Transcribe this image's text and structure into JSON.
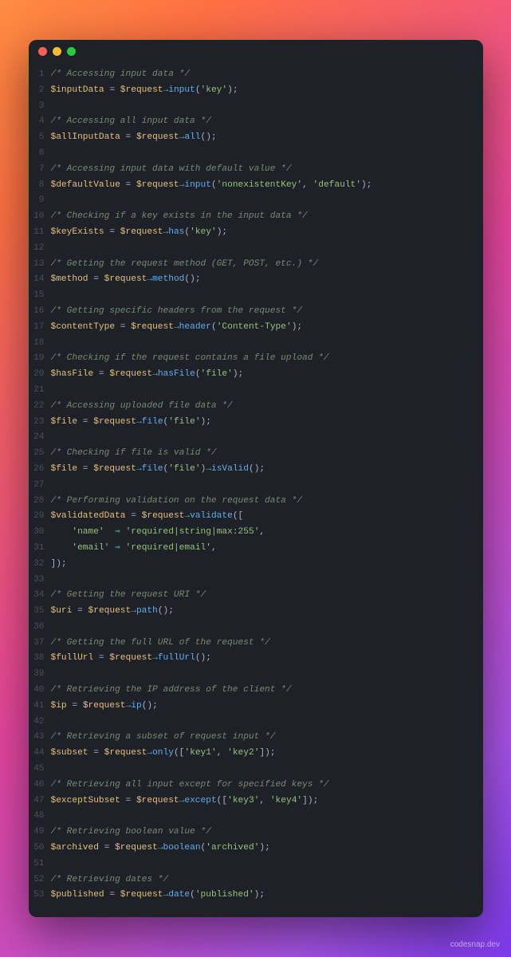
{
  "watermark": "codesnap.dev",
  "lines": [
    {
      "n": 1,
      "tokens": [
        {
          "t": "/* Accessing input data */",
          "c": "c"
        }
      ]
    },
    {
      "n": 2,
      "tokens": [
        {
          "t": "$inputData",
          "c": "v"
        },
        {
          "t": " = ",
          "c": "eq"
        },
        {
          "t": "$request",
          "c": "v"
        },
        {
          "t": "→",
          "c": "arr"
        },
        {
          "t": "input",
          "c": "fn"
        },
        {
          "t": "(",
          "c": "p"
        },
        {
          "t": "'key'",
          "c": "s"
        },
        {
          "t": ");",
          "c": "p"
        }
      ]
    },
    {
      "n": 3,
      "tokens": []
    },
    {
      "n": 4,
      "tokens": [
        {
          "t": "/* Accessing all input data */",
          "c": "c"
        }
      ]
    },
    {
      "n": 5,
      "tokens": [
        {
          "t": "$allInputData",
          "c": "v"
        },
        {
          "t": " = ",
          "c": "eq"
        },
        {
          "t": "$request",
          "c": "v"
        },
        {
          "t": "→",
          "c": "arr"
        },
        {
          "t": "all",
          "c": "fn"
        },
        {
          "t": "();",
          "c": "p"
        }
      ]
    },
    {
      "n": 6,
      "tokens": []
    },
    {
      "n": 7,
      "tokens": [
        {
          "t": "/* Accessing input data with default value */",
          "c": "c"
        }
      ]
    },
    {
      "n": 8,
      "tokens": [
        {
          "t": "$defaultValue",
          "c": "v"
        },
        {
          "t": " = ",
          "c": "eq"
        },
        {
          "t": "$request",
          "c": "v"
        },
        {
          "t": "→",
          "c": "arr"
        },
        {
          "t": "input",
          "c": "fn"
        },
        {
          "t": "(",
          "c": "p"
        },
        {
          "t": "'nonexistentKey'",
          "c": "s"
        },
        {
          "t": ", ",
          "c": "p"
        },
        {
          "t": "'default'",
          "c": "s"
        },
        {
          "t": ");",
          "c": "p"
        }
      ]
    },
    {
      "n": 9,
      "tokens": []
    },
    {
      "n": 10,
      "tokens": [
        {
          "t": "/* Checking if a key exists in the input data */",
          "c": "c"
        }
      ]
    },
    {
      "n": 11,
      "tokens": [
        {
          "t": "$keyExists",
          "c": "v"
        },
        {
          "t": " = ",
          "c": "eq"
        },
        {
          "t": "$request",
          "c": "v"
        },
        {
          "t": "→",
          "c": "arr"
        },
        {
          "t": "has",
          "c": "fn"
        },
        {
          "t": "(",
          "c": "p"
        },
        {
          "t": "'key'",
          "c": "s"
        },
        {
          "t": ");",
          "c": "p"
        }
      ]
    },
    {
      "n": 12,
      "tokens": []
    },
    {
      "n": 13,
      "tokens": [
        {
          "t": "/* Getting the request method (GET, POST, etc.) */",
          "c": "c"
        }
      ]
    },
    {
      "n": 14,
      "tokens": [
        {
          "t": "$method",
          "c": "v"
        },
        {
          "t": " = ",
          "c": "eq"
        },
        {
          "t": "$request",
          "c": "v"
        },
        {
          "t": "→",
          "c": "arr"
        },
        {
          "t": "method",
          "c": "fn"
        },
        {
          "t": "();",
          "c": "p"
        }
      ]
    },
    {
      "n": 15,
      "tokens": []
    },
    {
      "n": 16,
      "tokens": [
        {
          "t": "/* Getting specific headers from the request */",
          "c": "c"
        }
      ]
    },
    {
      "n": 17,
      "tokens": [
        {
          "t": "$contentType",
          "c": "v"
        },
        {
          "t": " = ",
          "c": "eq"
        },
        {
          "t": "$request",
          "c": "v"
        },
        {
          "t": "→",
          "c": "arr"
        },
        {
          "t": "header",
          "c": "fn"
        },
        {
          "t": "(",
          "c": "p"
        },
        {
          "t": "'Content-Type'",
          "c": "s"
        },
        {
          "t": ");",
          "c": "p"
        }
      ]
    },
    {
      "n": 18,
      "tokens": []
    },
    {
      "n": 19,
      "tokens": [
        {
          "t": "/* Checking if the request contains a file upload */",
          "c": "c"
        }
      ]
    },
    {
      "n": 20,
      "tokens": [
        {
          "t": "$hasFile",
          "c": "v"
        },
        {
          "t": " = ",
          "c": "eq"
        },
        {
          "t": "$request",
          "c": "v"
        },
        {
          "t": "→",
          "c": "arr"
        },
        {
          "t": "hasFile",
          "c": "fn"
        },
        {
          "t": "(",
          "c": "p"
        },
        {
          "t": "'file'",
          "c": "s"
        },
        {
          "t": ");",
          "c": "p"
        }
      ]
    },
    {
      "n": 21,
      "tokens": []
    },
    {
      "n": 22,
      "tokens": [
        {
          "t": "/* Accessing uploaded file data */",
          "c": "c"
        }
      ]
    },
    {
      "n": 23,
      "tokens": [
        {
          "t": "$file",
          "c": "v"
        },
        {
          "t": " = ",
          "c": "eq"
        },
        {
          "t": "$request",
          "c": "v"
        },
        {
          "t": "→",
          "c": "arr"
        },
        {
          "t": "file",
          "c": "fn"
        },
        {
          "t": "(",
          "c": "p"
        },
        {
          "t": "'file'",
          "c": "s"
        },
        {
          "t": ");",
          "c": "p"
        }
      ]
    },
    {
      "n": 24,
      "tokens": []
    },
    {
      "n": 25,
      "tokens": [
        {
          "t": "/* Checking if file is valid */",
          "c": "c"
        }
      ]
    },
    {
      "n": 26,
      "tokens": [
        {
          "t": "$file",
          "c": "v"
        },
        {
          "t": " = ",
          "c": "eq"
        },
        {
          "t": "$request",
          "c": "v"
        },
        {
          "t": "→",
          "c": "arr"
        },
        {
          "t": "file",
          "c": "fn"
        },
        {
          "t": "(",
          "c": "p"
        },
        {
          "t": "'file'",
          "c": "s"
        },
        {
          "t": ")",
          "c": "p"
        },
        {
          "t": "→",
          "c": "arr"
        },
        {
          "t": "isValid",
          "c": "fn"
        },
        {
          "t": "();",
          "c": "p"
        }
      ]
    },
    {
      "n": 27,
      "tokens": []
    },
    {
      "n": 28,
      "tokens": [
        {
          "t": "/* Performing validation on the request data */",
          "c": "c"
        }
      ]
    },
    {
      "n": 29,
      "tokens": [
        {
          "t": "$validatedData",
          "c": "v"
        },
        {
          "t": " = ",
          "c": "eq"
        },
        {
          "t": "$request",
          "c": "v"
        },
        {
          "t": "→",
          "c": "arr"
        },
        {
          "t": "validate",
          "c": "fn"
        },
        {
          "t": "([",
          "c": "p"
        }
      ]
    },
    {
      "n": 30,
      "tokens": [
        {
          "t": "    ",
          "c": "p"
        },
        {
          "t": "'name'",
          "c": "s"
        },
        {
          "t": "  ",
          "c": "p"
        },
        {
          "t": "⇒",
          "c": "arr"
        },
        {
          "t": " ",
          "c": "p"
        },
        {
          "t": "'required|string|max:255'",
          "c": "s"
        },
        {
          "t": ",",
          "c": "p"
        }
      ]
    },
    {
      "n": 31,
      "tokens": [
        {
          "t": "    ",
          "c": "p"
        },
        {
          "t": "'email'",
          "c": "s"
        },
        {
          "t": " ",
          "c": "p"
        },
        {
          "t": "⇒",
          "c": "arr"
        },
        {
          "t": " ",
          "c": "p"
        },
        {
          "t": "'required|email'",
          "c": "s"
        },
        {
          "t": ",",
          "c": "p"
        }
      ]
    },
    {
      "n": 32,
      "tokens": [
        {
          "t": "]);",
          "c": "p"
        }
      ]
    },
    {
      "n": 33,
      "tokens": []
    },
    {
      "n": 34,
      "tokens": [
        {
          "t": "/* Getting the request URI */",
          "c": "c"
        }
      ]
    },
    {
      "n": 35,
      "tokens": [
        {
          "t": "$uri",
          "c": "v"
        },
        {
          "t": " = ",
          "c": "eq"
        },
        {
          "t": "$request",
          "c": "v"
        },
        {
          "t": "→",
          "c": "arr"
        },
        {
          "t": "path",
          "c": "fn"
        },
        {
          "t": "();",
          "c": "p"
        }
      ]
    },
    {
      "n": 36,
      "tokens": []
    },
    {
      "n": 37,
      "tokens": [
        {
          "t": "/* Getting the full URL of the request */",
          "c": "c"
        }
      ]
    },
    {
      "n": 38,
      "tokens": [
        {
          "t": "$fullUrl",
          "c": "v"
        },
        {
          "t": " = ",
          "c": "eq"
        },
        {
          "t": "$request",
          "c": "v"
        },
        {
          "t": "→",
          "c": "arr"
        },
        {
          "t": "fullUrl",
          "c": "fn"
        },
        {
          "t": "();",
          "c": "p"
        }
      ]
    },
    {
      "n": 39,
      "tokens": []
    },
    {
      "n": 40,
      "tokens": [
        {
          "t": "/* Retrieving the IP address of the client */",
          "c": "c"
        }
      ]
    },
    {
      "n": 41,
      "tokens": [
        {
          "t": "$ip",
          "c": "v"
        },
        {
          "t": " = ",
          "c": "eq"
        },
        {
          "t": "$request",
          "c": "v"
        },
        {
          "t": "→",
          "c": "arr"
        },
        {
          "t": "ip",
          "c": "fn"
        },
        {
          "t": "();",
          "c": "p"
        }
      ]
    },
    {
      "n": 42,
      "tokens": []
    },
    {
      "n": 43,
      "tokens": [
        {
          "t": "/* Retrieving a subset of request input */",
          "c": "c"
        }
      ]
    },
    {
      "n": 44,
      "tokens": [
        {
          "t": "$subset",
          "c": "v"
        },
        {
          "t": " = ",
          "c": "eq"
        },
        {
          "t": "$request",
          "c": "v"
        },
        {
          "t": "→",
          "c": "arr"
        },
        {
          "t": "only",
          "c": "fn"
        },
        {
          "t": "([",
          "c": "p"
        },
        {
          "t": "'key1'",
          "c": "s"
        },
        {
          "t": ", ",
          "c": "p"
        },
        {
          "t": "'key2'",
          "c": "s"
        },
        {
          "t": "]);",
          "c": "p"
        }
      ]
    },
    {
      "n": 45,
      "tokens": []
    },
    {
      "n": 46,
      "tokens": [
        {
          "t": "/* Retrieving all input except for specified keys */",
          "c": "c"
        }
      ]
    },
    {
      "n": 47,
      "tokens": [
        {
          "t": "$exceptSubset",
          "c": "v"
        },
        {
          "t": " = ",
          "c": "eq"
        },
        {
          "t": "$request",
          "c": "v"
        },
        {
          "t": "→",
          "c": "arr"
        },
        {
          "t": "except",
          "c": "fn"
        },
        {
          "t": "([",
          "c": "p"
        },
        {
          "t": "'key3'",
          "c": "s"
        },
        {
          "t": ", ",
          "c": "p"
        },
        {
          "t": "'key4'",
          "c": "s"
        },
        {
          "t": "]);",
          "c": "p"
        }
      ]
    },
    {
      "n": 48,
      "tokens": []
    },
    {
      "n": 49,
      "tokens": [
        {
          "t": "/* Retrieving boolean value */",
          "c": "c"
        }
      ]
    },
    {
      "n": 50,
      "tokens": [
        {
          "t": "$archived",
          "c": "v"
        },
        {
          "t": " = ",
          "c": "eq"
        },
        {
          "t": "$request",
          "c": "v"
        },
        {
          "t": "→",
          "c": "arr"
        },
        {
          "t": "boolean",
          "c": "fn"
        },
        {
          "t": "(",
          "c": "p"
        },
        {
          "t": "'archived'",
          "c": "s"
        },
        {
          "t": ");",
          "c": "p"
        }
      ]
    },
    {
      "n": 51,
      "tokens": []
    },
    {
      "n": 52,
      "tokens": [
        {
          "t": "/* Retrieving dates */",
          "c": "c"
        }
      ]
    },
    {
      "n": 53,
      "tokens": [
        {
          "t": "$published",
          "c": "v"
        },
        {
          "t": " = ",
          "c": "eq"
        },
        {
          "t": "$request",
          "c": "v"
        },
        {
          "t": "→",
          "c": "arr"
        },
        {
          "t": "date",
          "c": "fn"
        },
        {
          "t": "(",
          "c": "p"
        },
        {
          "t": "'published'",
          "c": "s"
        },
        {
          "t": ");",
          "c": "p"
        }
      ]
    }
  ]
}
